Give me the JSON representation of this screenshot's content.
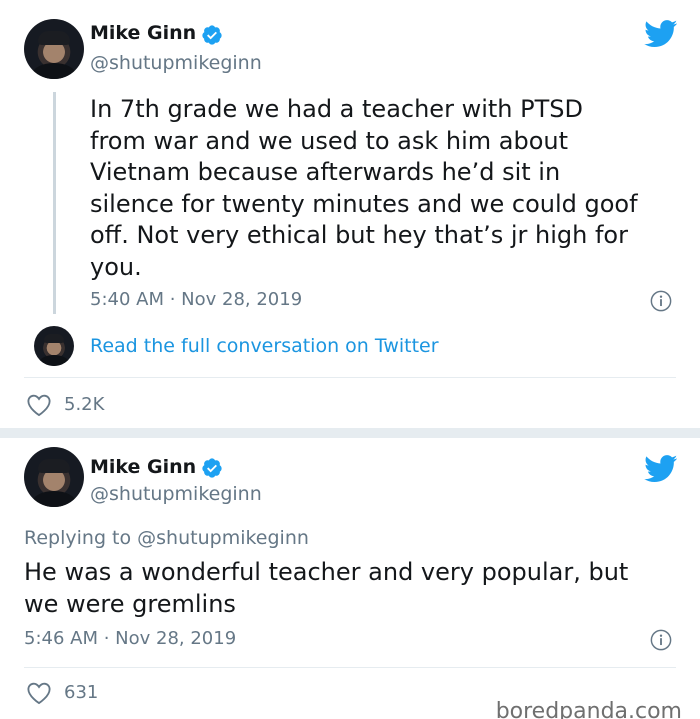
{
  "tweets": [
    {
      "author": {
        "name": "Mike Ginn",
        "handle": "@shutupmikeginn"
      },
      "text": "In 7th grade we had a teacher with PTSD\nfrom war and we used to ask him about\nVietnam because afterwards he’d sit in\nsilence for twenty minutes and we could goof\noff. Not very ethical but hey that’s jr high for\nyou.",
      "timestamp": "5:40 AM · Nov 28, 2019",
      "read_more": "Read the full conversation on Twitter",
      "likes": "5.2K"
    },
    {
      "author": {
        "name": "Mike Ginn",
        "handle": "@shutupmikeginn"
      },
      "replying_to": "Replying to @shutupmikeginn",
      "text": "He was a wonderful teacher and very popular, but\nwe were gremlins",
      "timestamp": "5:46 AM · Nov 28, 2019",
      "likes": "631"
    }
  ],
  "watermark": "boredpanda.com",
  "colors": {
    "twitter_blue": "#1da1f2",
    "link_blue": "#1b95e0",
    "muted_gray": "#657786",
    "divider": "#e6ecf0"
  },
  "icons": [
    "verified-badge-icon",
    "twitter-bird-icon",
    "info-icon",
    "heart-icon"
  ]
}
